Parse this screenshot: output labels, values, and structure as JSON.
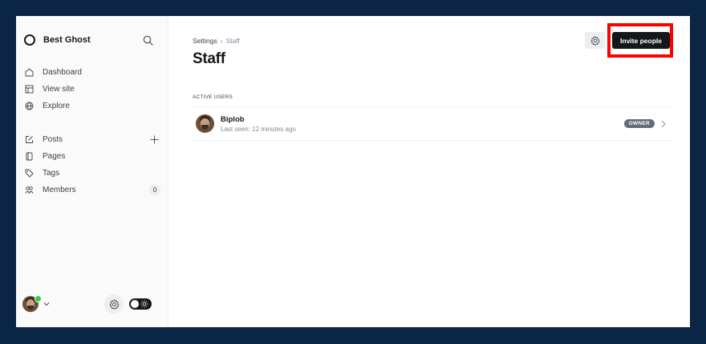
{
  "sidebar": {
    "brand": "Best Ghost",
    "primary_items": [
      {
        "label": "Dashboard",
        "icon": "home-icon"
      },
      {
        "label": "View site",
        "icon": "view-site-icon"
      },
      {
        "label": "Explore",
        "icon": "globe-icon"
      }
    ],
    "content_items": [
      {
        "label": "Posts",
        "icon": "edit-icon"
      },
      {
        "label": "Pages",
        "icon": "page-icon"
      },
      {
        "label": "Tags",
        "icon": "tag-icon"
      },
      {
        "label": "Members",
        "icon": "members-icon",
        "count": "0"
      }
    ]
  },
  "header": {
    "breadcrumb_root": "Settings",
    "breadcrumb_sep": "›",
    "breadcrumb_current": "Staff",
    "title": "Staff",
    "invite_label": "Invite people"
  },
  "active_users": {
    "section_label": "ACTIVE USERS",
    "users": [
      {
        "name": "Biplob",
        "last_seen": "Last seen: 12 minutes ago",
        "role": "OWNER"
      }
    ]
  },
  "colors": {
    "background": "#0b2545",
    "accent_highlight": "#ff0000",
    "online": "#30cf43"
  }
}
